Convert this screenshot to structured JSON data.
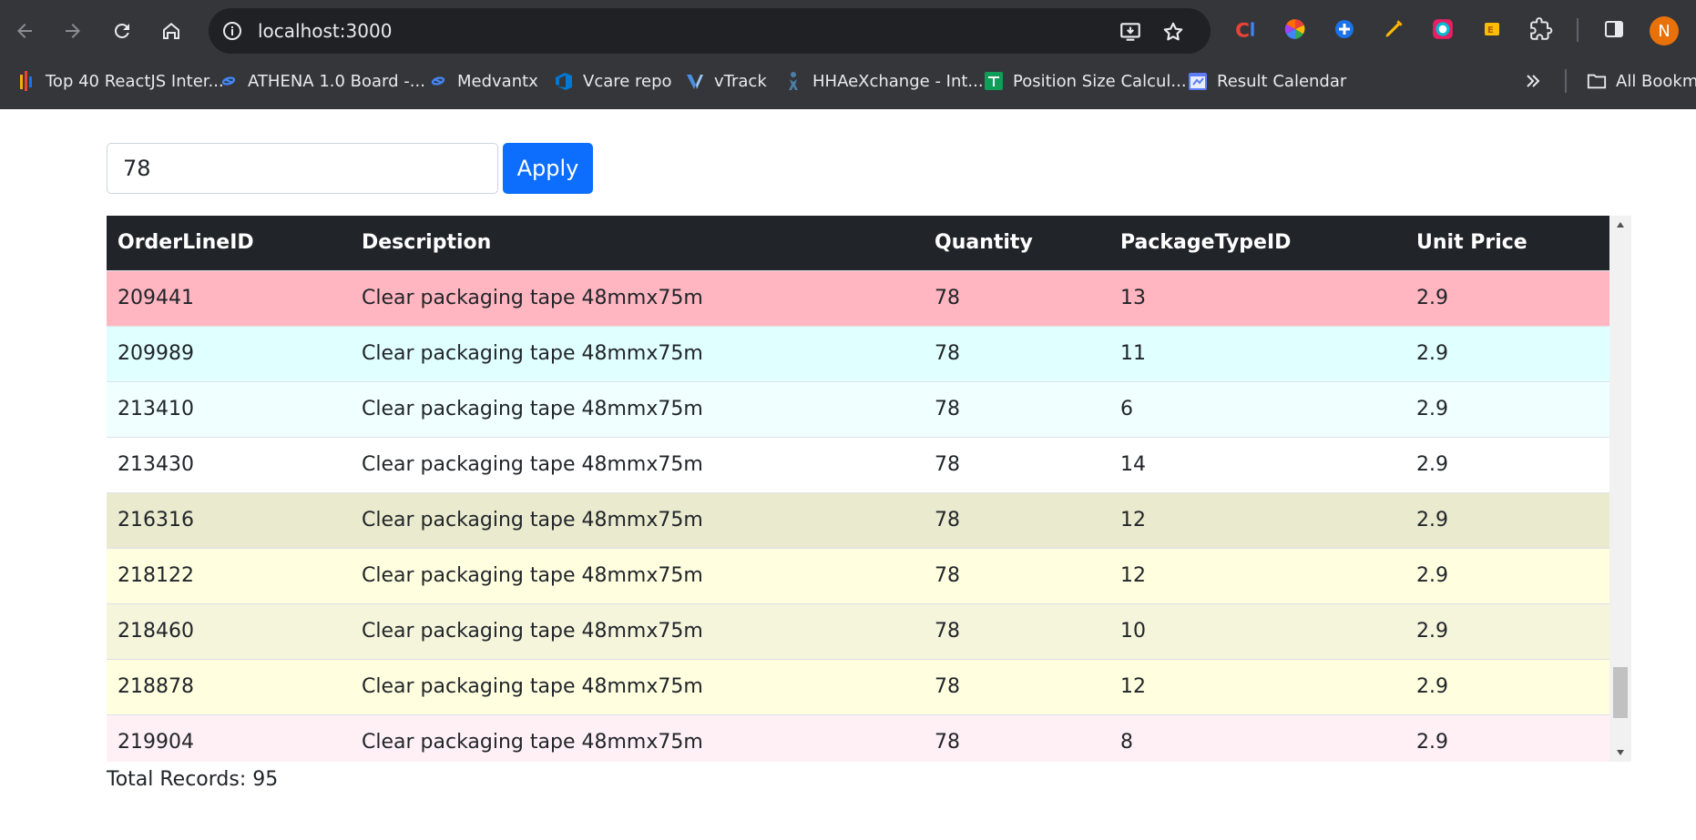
{
  "browser": {
    "url": "localhost:3000",
    "profile_initial": "N",
    "bookmarks": [
      {
        "label": "Top 40 ReactJS Inter...",
        "icon": "bars-icon"
      },
      {
        "label": "ATHENA 1.0 Board -...",
        "icon": "infinity-icon"
      },
      {
        "label": "Medvantx",
        "icon": "infinity-icon"
      },
      {
        "label": "Vcare repo",
        "icon": "azure-devops-icon"
      },
      {
        "label": "vTrack",
        "icon": "v-logo-icon"
      },
      {
        "label": "HHAeXchange - Int...",
        "icon": "figure-icon"
      },
      {
        "label": "Position Size Calcul...",
        "icon": "sheets-icon"
      },
      {
        "label": "Result Calendar",
        "icon": "calendar-icon"
      }
    ],
    "all_bookmarks_label": "All Bookma"
  },
  "filter": {
    "value": "78",
    "apply_label": "Apply"
  },
  "table": {
    "columns": [
      "OrderLineID",
      "Description",
      "Quantity",
      "PackageTypeID",
      "Unit Price"
    ],
    "rows": [
      {
        "id": "209441",
        "desc": "Clear packaging tape 48mmx75m",
        "qty": "78",
        "pkg": "13",
        "price": "2.9",
        "color": "#ffb6c1"
      },
      {
        "id": "209989",
        "desc": "Clear packaging tape 48mmx75m",
        "qty": "78",
        "pkg": "11",
        "price": "2.9",
        "color": "#e0ffff"
      },
      {
        "id": "213410",
        "desc": "Clear packaging tape 48mmx75m",
        "qty": "78",
        "pkg": "6",
        "price": "2.9",
        "color": "#f0ffff"
      },
      {
        "id": "213430",
        "desc": "Clear packaging tape 48mmx75m",
        "qty": "78",
        "pkg": "14",
        "price": "2.9",
        "color": "#ffffff"
      },
      {
        "id": "216316",
        "desc": "Clear packaging tape 48mmx75m",
        "qty": "78",
        "pkg": "12",
        "price": "2.9",
        "color": "#eaeace"
      },
      {
        "id": "218122",
        "desc": "Clear packaging tape 48mmx75m",
        "qty": "78",
        "pkg": "12",
        "price": "2.9",
        "color": "#ffffe0"
      },
      {
        "id": "218460",
        "desc": "Clear packaging tape 48mmx75m",
        "qty": "78",
        "pkg": "10",
        "price": "2.9",
        "color": "#f5f5dc"
      },
      {
        "id": "218878",
        "desc": "Clear packaging tape 48mmx75m",
        "qty": "78",
        "pkg": "12",
        "price": "2.9",
        "color": "#ffffe0"
      },
      {
        "id": "219904",
        "desc": "Clear packaging tape 48mmx75m",
        "qty": "78",
        "pkg": "8",
        "price": "2.9",
        "color": "#fff0f5"
      }
    ]
  },
  "total_records": "Total Records: 95"
}
